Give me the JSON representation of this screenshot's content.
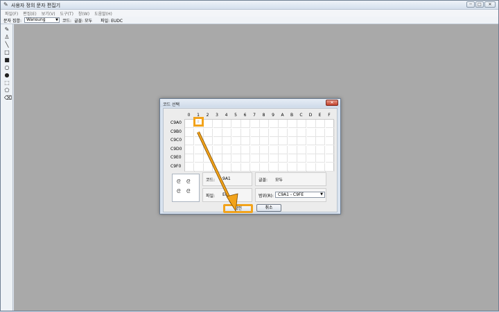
{
  "window": {
    "title": "사용자 정의 문자 편집기",
    "buttons": {
      "minimize": "─",
      "maximize": "□",
      "close": "✕"
    }
  },
  "menu": [
    "파일(F)",
    "편집(E)",
    "보기(V)",
    "도구(T)",
    "창(W)",
    "도움말(H)"
  ],
  "toolbar": {
    "charset_label": "문자 집합:",
    "charset_value": "Wansung",
    "code_label": "코드:",
    "font_label": "글꼴: 모두",
    "file_label": "파일: EUDC"
  },
  "tools": [
    "pencil-icon",
    "brush-icon",
    "line-icon",
    "hollow-rect-icon",
    "filled-rect-icon",
    "hollow-ellipse-icon",
    "filled-ellipse-icon",
    "rect-select-icon",
    "freeform-select-icon",
    "eraser-icon"
  ],
  "dialog": {
    "title": "코드 선택",
    "close": "✕",
    "columns": [
      "0",
      "1",
      "2",
      "3",
      "4",
      "5",
      "6",
      "7",
      "8",
      "9",
      "A",
      "B",
      "C",
      "D",
      "E",
      "F"
    ],
    "rows": [
      "C9A0",
      "C9B0",
      "C9C0",
      "C9D0",
      "C9E0",
      "C9F0"
    ],
    "selected_cell_text": "::",
    "code_label": "코드:",
    "code_value": "9A1",
    "font_label": "글꼴:",
    "font_value": "모두",
    "file_label": "파일:",
    "file_value": "EU",
    "range_label": "범위(R):",
    "range_value": "C9A1 - C9FE",
    "ok": "확인",
    "cancel": "취소"
  },
  "colors": {
    "highlight": "#f2a31b",
    "arrow": "#f2a31b",
    "canvas": "#a9a9a9"
  }
}
